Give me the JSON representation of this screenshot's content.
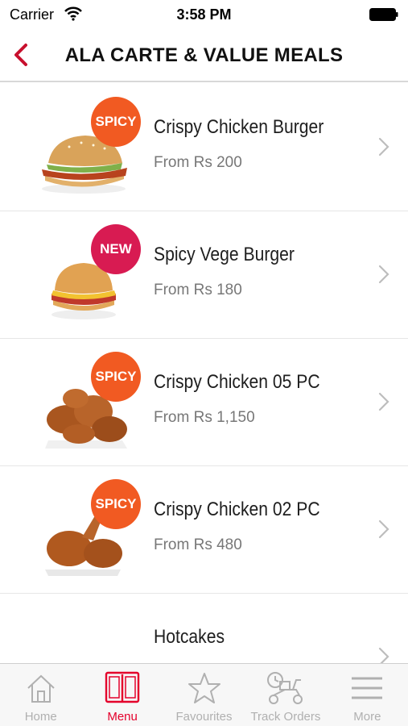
{
  "status": {
    "carrier": "Carrier",
    "time": "3:58 PM"
  },
  "header": {
    "title": "ALA CARTE & VALUE MEALS"
  },
  "items": [
    {
      "name": "Crispy Chicken Burger",
      "price": "From Rs 200",
      "badge": "SPICY"
    },
    {
      "name": "Spicy Vege Burger",
      "price": "From Rs 180",
      "badge": "NEW"
    },
    {
      "name": "Crispy Chicken 05 PC",
      "price": "From Rs 1,150",
      "badge": "SPICY"
    },
    {
      "name": "Crispy Chicken 02 PC",
      "price": "From Rs 480",
      "badge": "SPICY"
    },
    {
      "name": "Hotcakes",
      "price": "",
      "badge": ""
    }
  ],
  "tabs": [
    {
      "label": "Home",
      "icon": "home-icon"
    },
    {
      "label": "Menu",
      "icon": "book-icon",
      "active": true
    },
    {
      "label": "Favourites",
      "icon": "star-icon"
    },
    {
      "label": "Track Orders",
      "icon": "scooter-icon"
    },
    {
      "label": "More",
      "icon": "hamburger-icon"
    }
  ],
  "colors": {
    "accent": "#e4002b",
    "spicy": "#f15a22",
    "new": "#d81b52"
  }
}
